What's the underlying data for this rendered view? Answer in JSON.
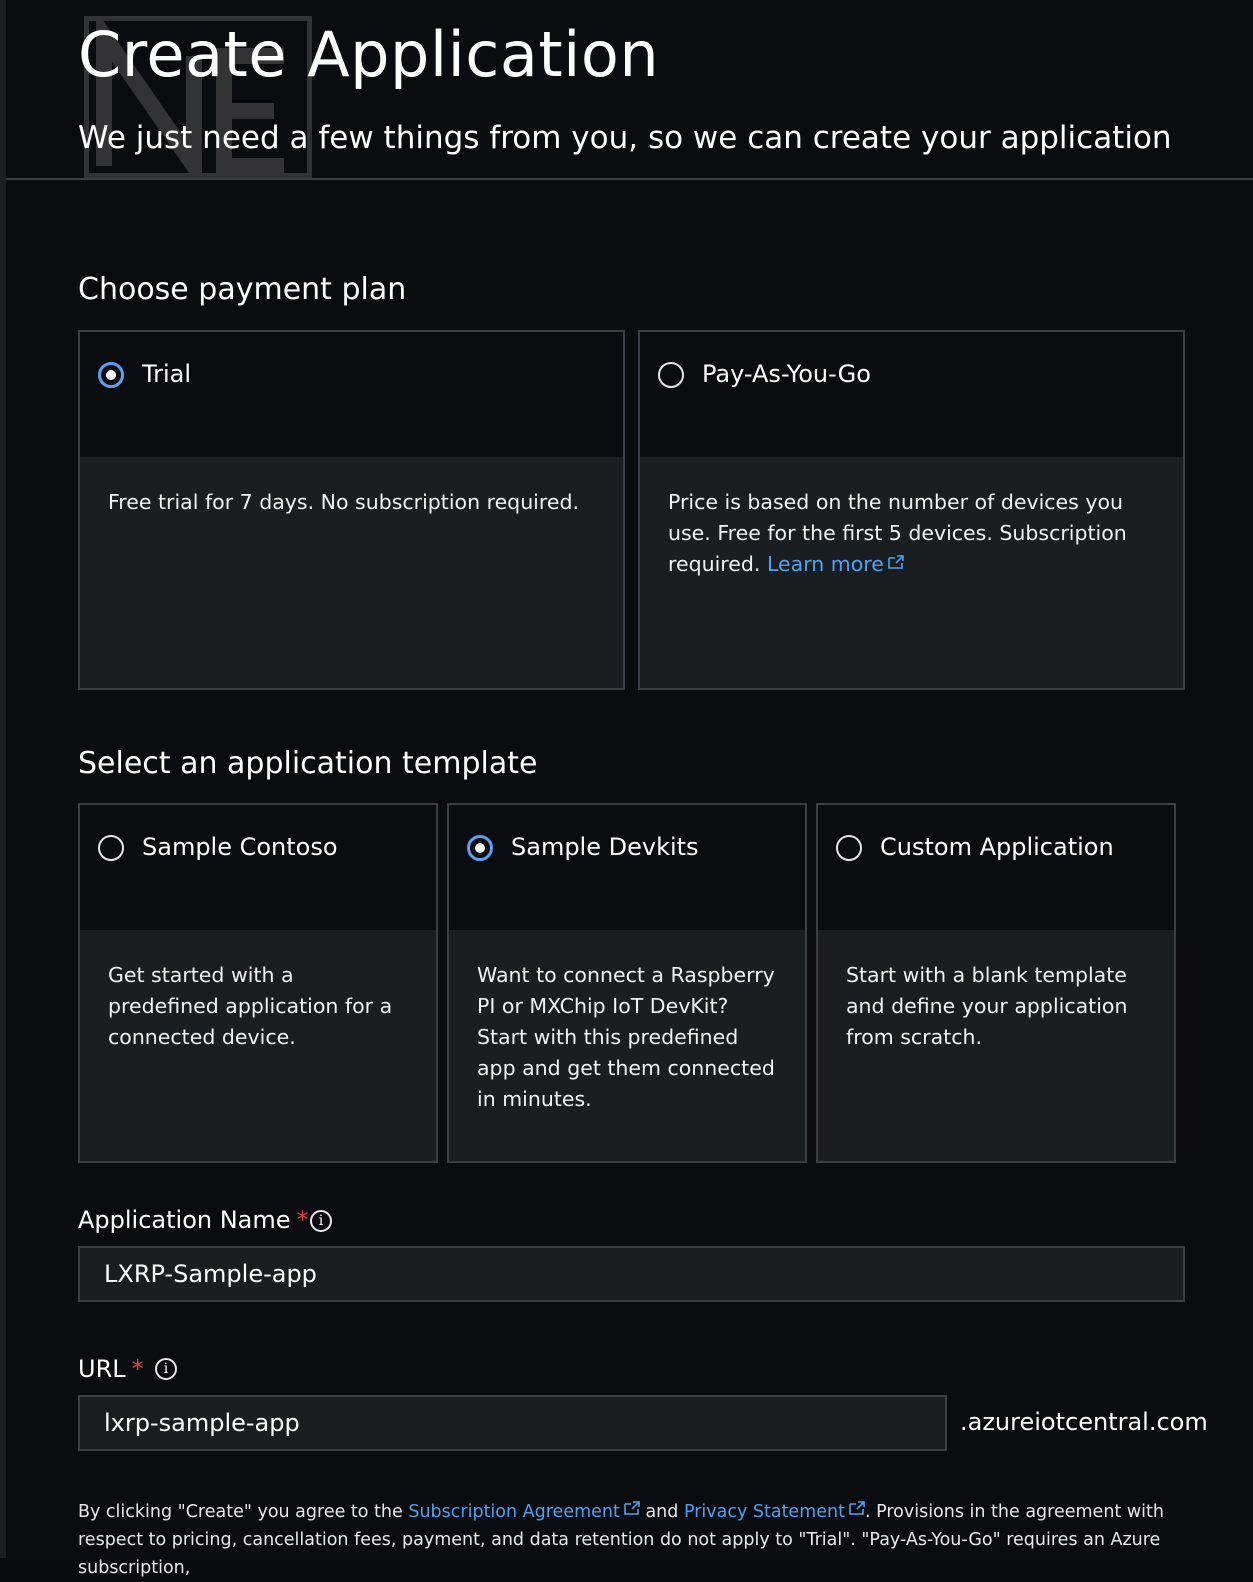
{
  "header": {
    "title": "Create Application",
    "subtitle": "We just need a few things from you, so we can create your application"
  },
  "payment": {
    "section_title": "Choose payment plan",
    "plans": [
      {
        "label": "Trial",
        "selected": true,
        "description": "Free trial for 7 days. No subscription required."
      },
      {
        "label": "Pay-As-You-Go",
        "selected": false,
        "description": "Price is based on the number of devices you use. Free for the first 5 devices. Subscription required.",
        "link_label": "Learn more"
      }
    ]
  },
  "templates": {
    "section_title": "Select an application template",
    "items": [
      {
        "label": "Sample Contoso",
        "selected": false,
        "description": "Get started with a predefined application for a connected device."
      },
      {
        "label": "Sample Devkits",
        "selected": true,
        "description": "Want to connect a Raspberry PI or MXChip IoT DevKit? Start with this predefined app and get them connected in minutes."
      },
      {
        "label": "Custom Application",
        "selected": false,
        "description": "Start with a blank template and define your application from scratch."
      }
    ]
  },
  "form": {
    "app_name": {
      "label": "Application Name",
      "required_mark": "*",
      "value": "LXRP-Sample-app"
    },
    "url": {
      "label": "URL",
      "required_mark": "*",
      "value": "lxrp-sample-app",
      "suffix": ".azureiotcentral.com"
    }
  },
  "legal": {
    "prefix": "By clicking \"Create\" you agree to the",
    "subscription_link": "Subscription Agreement",
    "and": "and",
    "privacy_link": "Privacy Statement",
    "rest": ". Provisions in the agreement with respect to pricing, cancellation fees, payment, and data retention do not apply to \"Trial\". \"Pay-As-You-Go\" requires an Azure subscription,"
  },
  "colors": {
    "accent": "#5aa0ef",
    "link": "#4aa3f5",
    "required": "#e04040",
    "card_body": "#1b1e21",
    "background": "#0b0c0f"
  },
  "icons": {
    "radio": "radio-button",
    "external": "external-link-icon",
    "info": "info-icon"
  }
}
